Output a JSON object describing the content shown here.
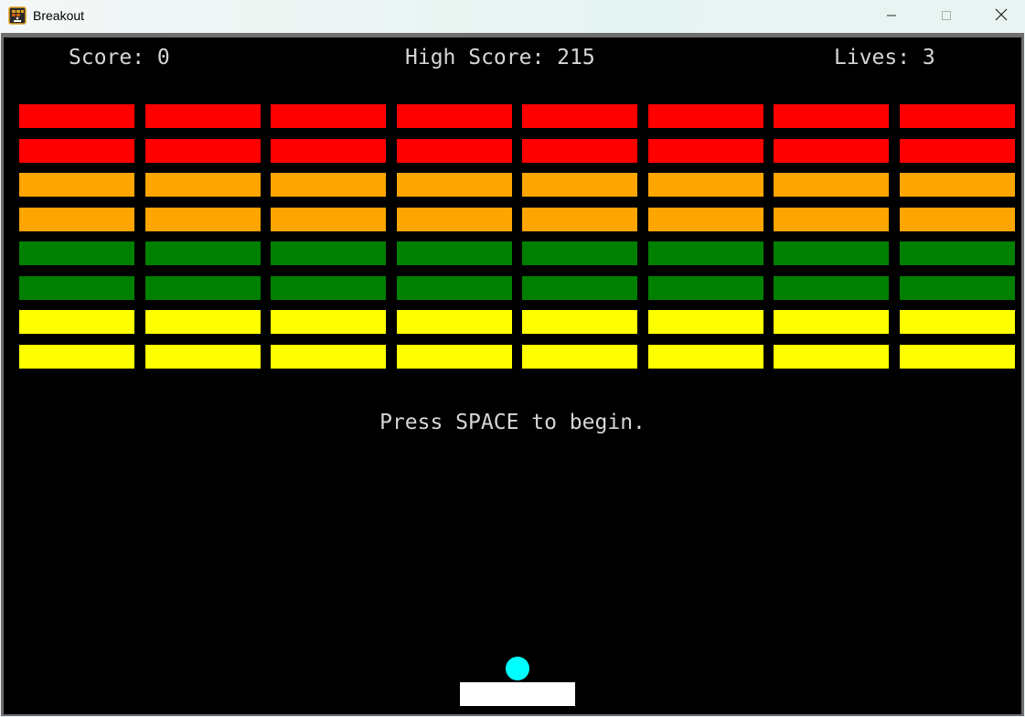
{
  "window": {
    "title": "Breakout",
    "icon": "breakout-app-icon"
  },
  "controls": {
    "minimize_icon": "minimize-icon",
    "maximize_icon": "maximize-icon",
    "close_icon": "close-icon"
  },
  "hud": {
    "score_text": "Score: 0",
    "high_score_text": "High Score: 215",
    "lives_text": "Lives: 3",
    "score": 0,
    "high_score": 215,
    "lives": 3
  },
  "message": "Press SPACE to begin.",
  "game": {
    "background_color": "#000000",
    "text_color": "#d6d6d6",
    "brick_columns": 8,
    "brick_row_colors": [
      "#ff0000",
      "#ff0000",
      "#ffa500",
      "#ffa500",
      "#008000",
      "#008000",
      "#ffff00",
      "#ffff00"
    ],
    "paddle_color": "#ffffff",
    "ball_color": "#00ffff"
  }
}
